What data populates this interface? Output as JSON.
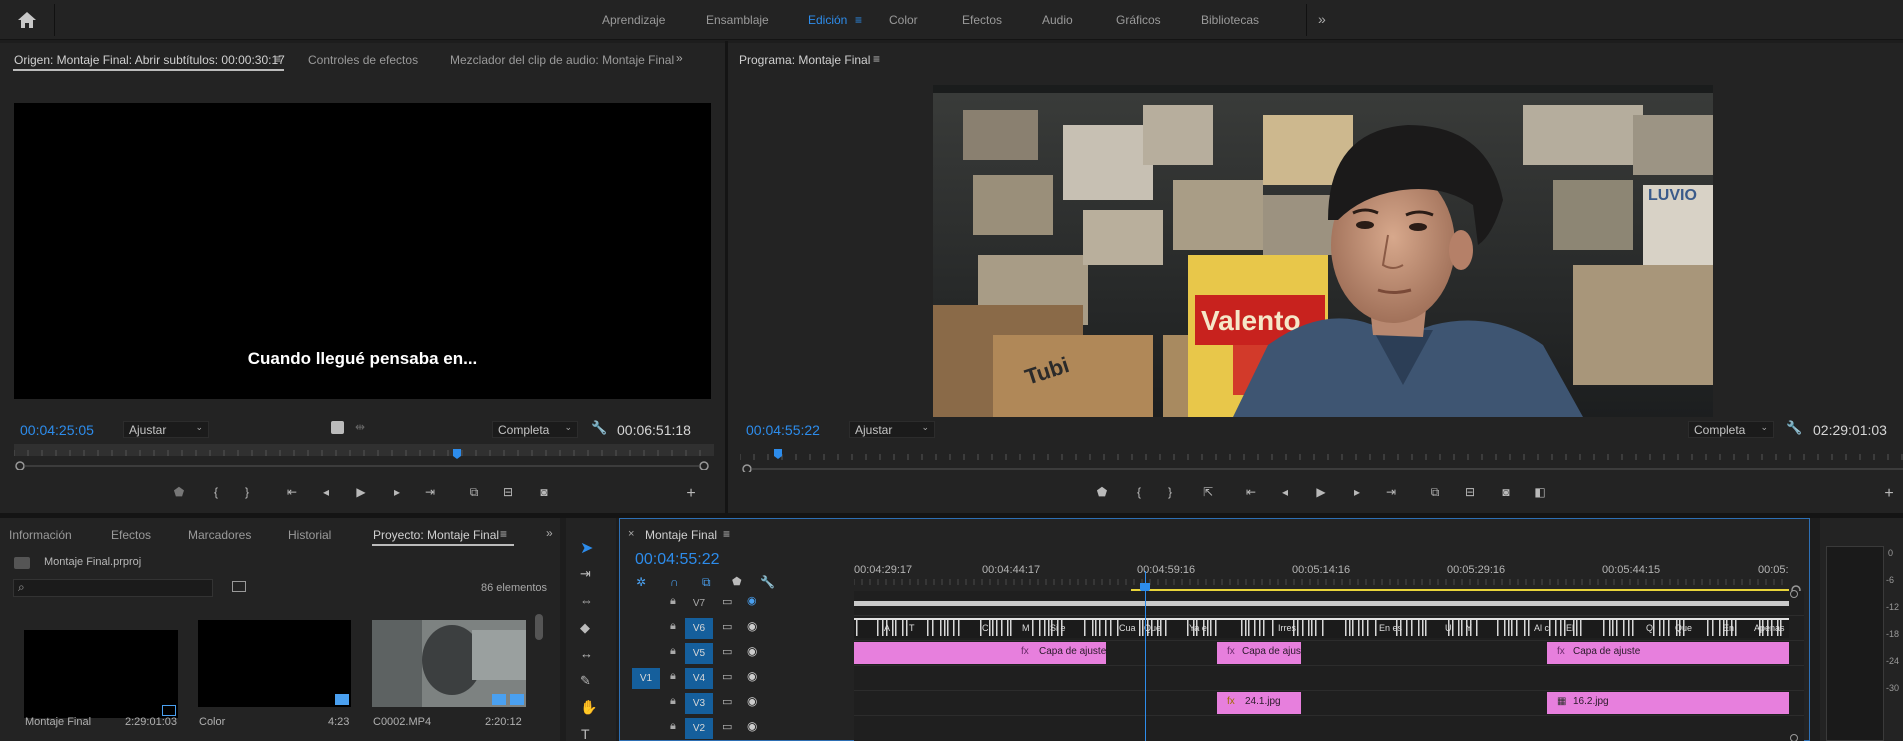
{
  "workspaces": {
    "items": [
      "Aprendizaje",
      "Ensamblaje",
      "Edición",
      "Color",
      "Efectos",
      "Audio",
      "Gráficos",
      "Bibliotecas"
    ],
    "active": "Edición",
    "menu_glyph": "≡",
    "more_glyph": "»"
  },
  "source_panel": {
    "tabs": [
      "Origen: Montaje Final: Abrir subtítulos: 00:00:30:17",
      "Controles de efectos",
      "Mezclador del clip de audio: Montaje Final"
    ],
    "subtitle": "Cuando llegué pensaba en...",
    "timecode_in": "00:04:25:05",
    "zoom": "Ajustar",
    "quality": "Completa",
    "duration": "00:06:51:18"
  },
  "program_panel": {
    "title": "Programa: Montaje Final",
    "timecode": "00:04:55:22",
    "zoom": "Ajustar",
    "quality": "Completa",
    "duration": "02:29:01:03"
  },
  "project_panel": {
    "tabs": [
      "Información",
      "Efectos",
      "Marcadores",
      "Historial",
      "Proyecto: Montaje Final"
    ],
    "file": "Montaje Final.prproj",
    "count": "86 elementos",
    "items": [
      {
        "name": "Montaje Final",
        "duration": "2:29:01:03"
      },
      {
        "name": "Color",
        "duration": "4:23"
      },
      {
        "name": "C0002.MP4",
        "duration": "2:20:12"
      }
    ]
  },
  "timeline": {
    "title": "Montaje Final",
    "timecode": "00:04:55:22",
    "ruler_labels": [
      "00:04:29:17",
      "00:04:44:17",
      "00:04:59:16",
      "00:05:14:16",
      "00:05:29:16",
      "00:05:44:15",
      "00:05:"
    ],
    "source_patch": "V1",
    "tracks": [
      "V7",
      "V6",
      "V5",
      "V4",
      "V3",
      "V2"
    ],
    "subtitle_words": [
      "A",
      "T",
      "C",
      "M",
      "Si e",
      "Cua",
      "Que",
      "Ya e",
      "Irres",
      "En es",
      "Ui",
      "Y",
      "Al c",
      "El",
      "Q",
      "Que",
      "En",
      "Apenas"
    ],
    "v5_clips": [
      {
        "label": "Capa de ajuste"
      },
      {
        "label": "Capa de ajus"
      },
      {
        "label": "Capa de ajuste"
      }
    ],
    "v3_clips": [
      {
        "label": "24.1.jpg"
      },
      {
        "label": "16.2.jpg"
      }
    ]
  },
  "meters": {
    "labels": [
      "0",
      "-6",
      "-12",
      "-18",
      "-24",
      "-30"
    ]
  },
  "colors": {
    "accent": "#2d8ceb",
    "clip": "#e77fdd",
    "playhead": "#2d8ceb",
    "work_area": "#e8d43a"
  }
}
